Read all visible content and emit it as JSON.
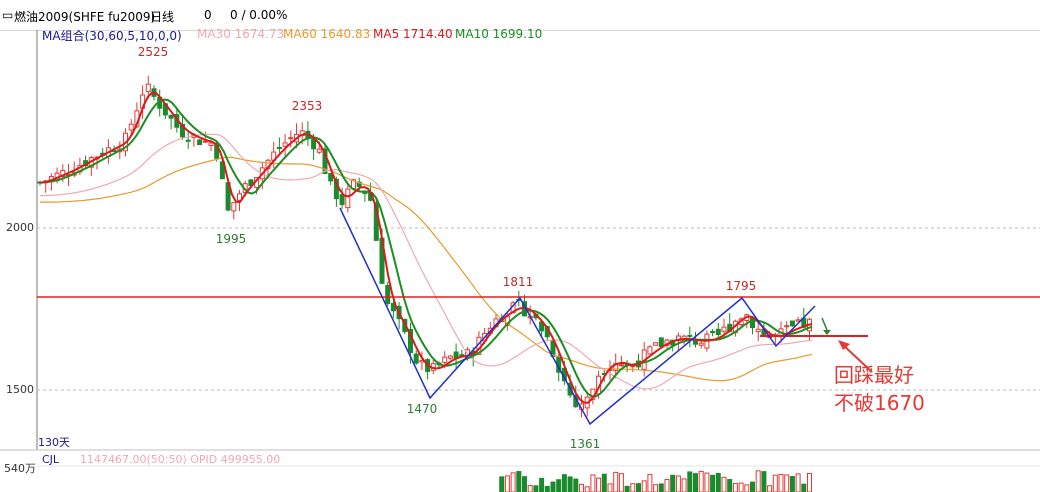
{
  "header": {
    "symbol": "燃油2009(SHFE fu2009)",
    "period": "日线",
    "change": "0",
    "pct": "0 / 0.00%"
  },
  "ma_legend": {
    "label": "MA组合(30,60,5,10,0,0)",
    "ma30": "MA30 1674.73",
    "ma60": "MA60 1640.83",
    "ma5": "MA5 1714.40",
    "ma10": "MA10 1699.10"
  },
  "volume_legend": {
    "label": "CJL",
    "values": "1147467.00(50:50)  OPID 499955.00",
    "scale": "540万"
  },
  "days_label": "130天",
  "annotation": {
    "line1": "回踩最好",
    "line2": "不破1670"
  },
  "colors": {
    "up": "#e53935",
    "down": "#1b8a2e",
    "ma5": "#d81b1b",
    "ma10": "#1a8f22",
    "ma30": "#f2a8b0",
    "ma60": "#e69a2e",
    "trend": "#1f2fd0",
    "resistance": "#e02020"
  },
  "chart_data": {
    "type": "candlestick",
    "y_ticks": [
      2000,
      1500
    ],
    "ylim": [
      1340,
      2600
    ],
    "peaks": [
      {
        "label": "2525",
        "value": 2525,
        "kind": "high"
      },
      {
        "label": "1995",
        "value": 1995,
        "kind": "low"
      },
      {
        "label": "2353",
        "value": 2353,
        "kind": "high"
      },
      {
        "label": "1470",
        "value": 1470,
        "kind": "low"
      },
      {
        "label": "1811",
        "value": 1811,
        "kind": "high"
      },
      {
        "label": "1361",
        "value": 1361,
        "kind": "low"
      },
      {
        "label": "1795",
        "value": 1795,
        "kind": "high"
      }
    ],
    "resistance_level": 1795,
    "support_level": 1670,
    "ma_last": {
      "MA30": 1674.73,
      "MA60": 1640.83,
      "MA5": 1714.4,
      "MA10": 1699.1
    }
  }
}
